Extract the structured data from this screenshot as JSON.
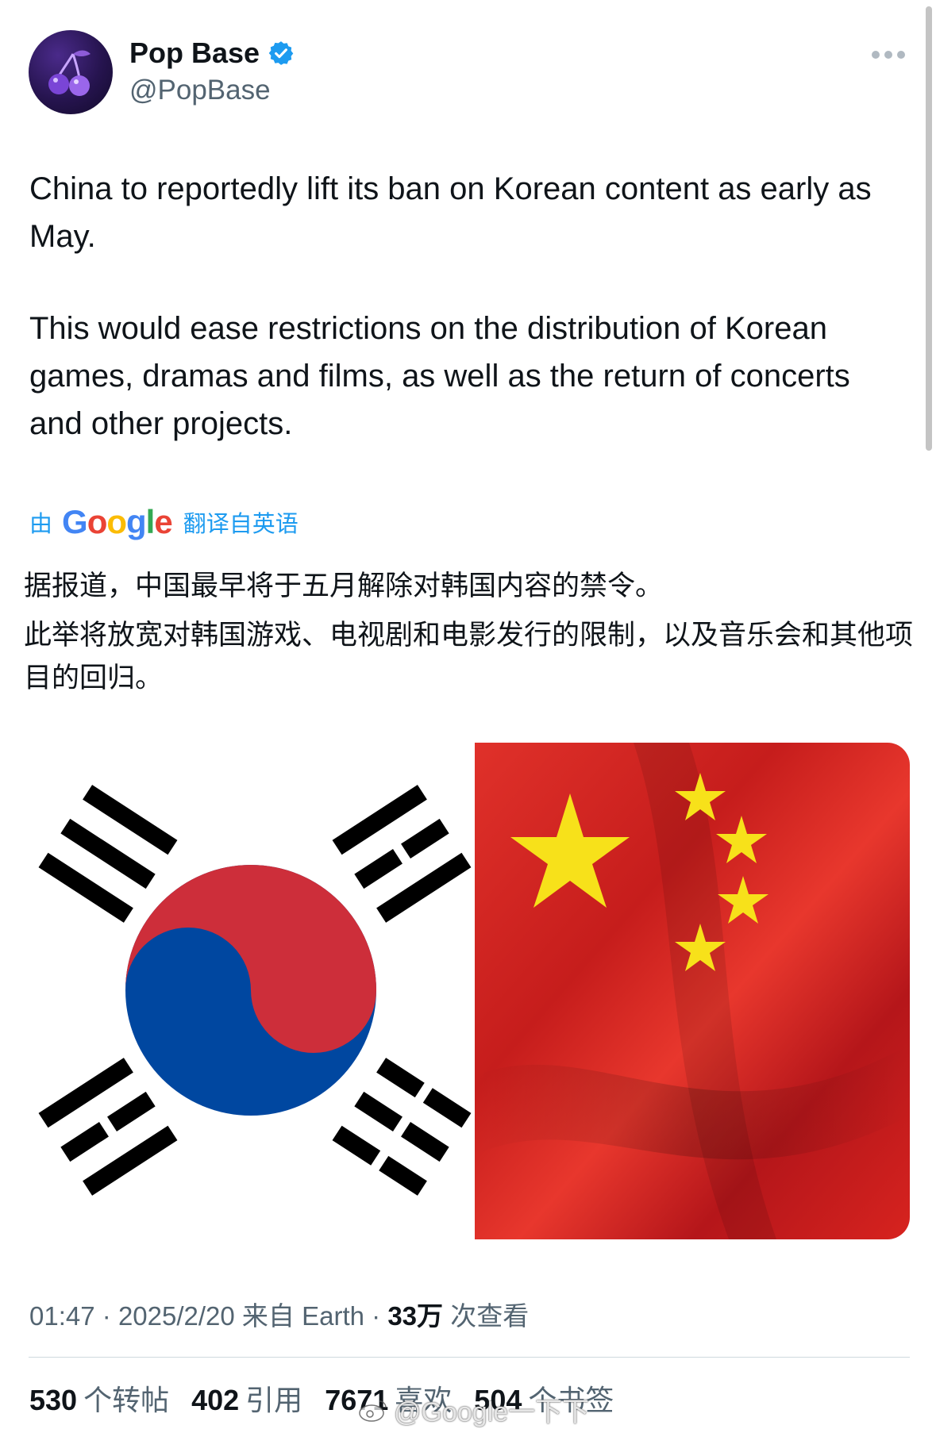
{
  "author": {
    "display_name": "Pop Base",
    "handle": "@PopBase",
    "verified": true,
    "avatar_icon": "cherries-icon"
  },
  "tweet": {
    "paragraphs": [
      "China to reportedly lift its ban on Korean content as early as May.",
      "This would ease restrictions on the distribution of Korean games, dramas and films, as well as the return of concerts and other projects."
    ]
  },
  "translation_banner": {
    "prefix": "由",
    "brand": "Google",
    "suffix": "翻译自英语"
  },
  "translation": {
    "paragraphs": [
      "据报道，中国最早将于五月解除对韩国内容的禁令。",
      "此举将放宽对韩国游戏、电视剧和电影发行的限制，以及音乐会和其他项目的回归。"
    ]
  },
  "media": {
    "left_image": "south-korea-flag",
    "right_image": "china-flag"
  },
  "meta": {
    "time": "01:47",
    "date": "2025/2/20",
    "source": "来自 Earth",
    "views_count": "33万",
    "views_label": "次查看"
  },
  "stats": [
    {
      "count": "530",
      "label": "个转帖"
    },
    {
      "count": "402",
      "label": "引用"
    },
    {
      "count": "7671",
      "label": "喜欢"
    },
    {
      "count": "504",
      "label": "个书签"
    }
  ],
  "watermark": "@Google一下下",
  "colors": {
    "accent": "#1d9bf0",
    "secondary_text": "#536471",
    "primary_text": "#0f1419",
    "china_red": "#d7231f",
    "china_yellow": "#f7e11a",
    "korea_red": "#cd2e3a",
    "korea_blue": "#0047a0"
  }
}
